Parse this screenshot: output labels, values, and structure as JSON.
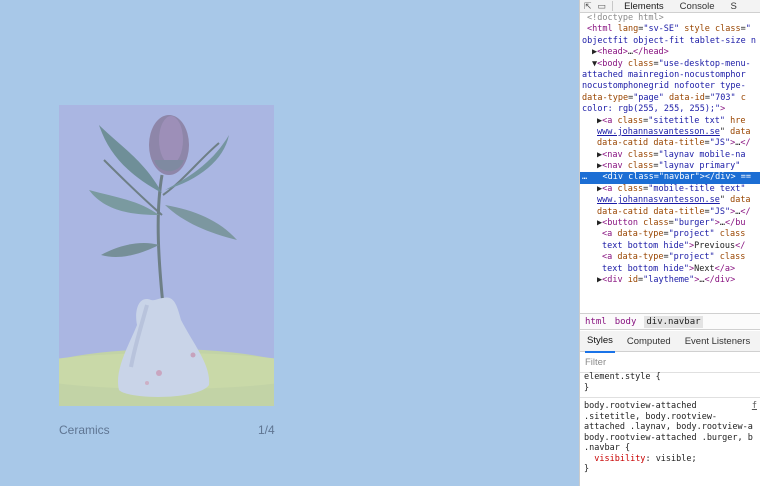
{
  "page": {
    "caption_title": "Ceramics",
    "caption_count": "1/4"
  },
  "devtools": {
    "toolbar": {
      "inspect_icon": "cursor-select-icon",
      "device_icon": "device-toggle-icon",
      "tabs": [
        "Elements",
        "Console",
        "S"
      ]
    },
    "elements_lines": [
      {
        "indent": 1,
        "html": "<span class='c-com'>&lt;!doctype html&gt;</span>"
      },
      {
        "indent": 1,
        "html": "<span class='c-tag'>&lt;html</span> <span class='c-attr'>lang</span>=<span class='c-val'>\"sv-SE\"</span> <span class='c-attr'>style</span> <span class='c-attr'>class</span>=<span class='c-val'>\"</span>"
      },
      {
        "indent": 0,
        "html": "<span class='c-val'>objectfit object-fit tablet-size n</span>"
      },
      {
        "indent": 2,
        "html": "▶<span class='c-tag'>&lt;head&gt;</span>…<span class='c-tag'>&lt;/head&gt;</span>"
      },
      {
        "indent": 2,
        "html": "▼<span class='c-tag'>&lt;body</span> <span class='c-attr'>class</span>=<span class='c-val'>\"use-desktop-menu-</span>"
      },
      {
        "indent": 0,
        "html": "<span class='c-val'>attached mainregion-nocustomphor</span>"
      },
      {
        "indent": 0,
        "html": "<span class='c-val'>nocustomphonegrid nofooter type-</span>"
      },
      {
        "indent": 0,
        "html": "<span class='c-attr'>data-type</span>=<span class='c-val'>\"page\"</span> <span class='c-attr'>data-id</span>=<span class='c-val'>\"703\"</span> <span class='c-attr'>c</span>"
      },
      {
        "indent": 0,
        "html": "<span class='c-val'>color: rgb(255, 255, 255);\"</span><span class='c-tag'>&gt;</span>"
      },
      {
        "indent": 3,
        "html": "▶<span class='c-tag'>&lt;a</span> <span class='c-attr'>class</span>=<span class='c-val'>\"sitetitle txt\"</span> <span class='c-attr'>hre</span>"
      },
      {
        "indent": 3,
        "html": "<span class='c-link'>www.johannasvantesson.se</span>\" <span class='c-attr'>data</span>"
      },
      {
        "indent": 3,
        "html": "<span class='c-attr'>data-catid</span> <span class='c-attr'>data-title</span>=<span class='c-val'>\"JS\"</span><span class='c-tag'>&gt;</span>…<span class='c-tag'>&lt;/</span>"
      },
      {
        "indent": 3,
        "html": "▶<span class='c-tag'>&lt;nav</span> <span class='c-attr'>class</span>=<span class='c-val'>\"laynav mobile-na</span>"
      },
      {
        "indent": 3,
        "html": "▶<span class='c-tag'>&lt;nav</span> <span class='c-attr'>class</span>=<span class='c-val'>\"laynav primary\"</span>"
      },
      {
        "indent": 0,
        "selected": true,
        "html": "…&nbsp;&nbsp;&nbsp;<span class='c-tag'>&lt;div</span> <span class='c-attr'>class</span>=<span class='c-val'>\"navbar\"</span><span class='c-tag'>&gt;&lt;/div&gt;</span> =="
      },
      {
        "indent": 3,
        "html": "▶<span class='c-tag'>&lt;a</span> <span class='c-attr'>class</span>=<span class='c-val'>\"mobile-title text\"</span>"
      },
      {
        "indent": 3,
        "html": "<span class='c-link'>www.johannasvantesson.se</span>\" <span class='c-attr'>data</span>"
      },
      {
        "indent": 3,
        "html": "<span class='c-attr'>data-catid</span> <span class='c-attr'>data-title</span>=<span class='c-val'>\"JS\"</span><span class='c-tag'>&gt;</span>…<span class='c-tag'>&lt;/</span>"
      },
      {
        "indent": 3,
        "html": "▶<span class='c-tag'>&lt;button</span> <span class='c-attr'>class</span>=<span class='c-val'>\"burger\"</span><span class='c-tag'>&gt;</span>…<span class='c-tag'>&lt;/bu</span>"
      },
      {
        "indent": 4,
        "html": "<span class='c-tag'>&lt;a</span> <span class='c-attr'>data-type</span>=<span class='c-val'>\"project\"</span> <span class='c-attr'>class</span>"
      },
      {
        "indent": 4,
        "html": "<span class='c-val'>text bottom hide\"</span><span class='c-tag'>&gt;</span>Previous<span class='c-tag'>&lt;/</span>"
      },
      {
        "indent": 4,
        "html": "<span class='c-tag'>&lt;a</span> <span class='c-attr'>data-type</span>=<span class='c-val'>\"project\"</span> <span class='c-attr'>class</span>"
      },
      {
        "indent": 4,
        "html": "<span class='c-val'>text bottom hide\"</span><span class='c-tag'>&gt;</span>Next<span class='c-tag'>&lt;/a&gt;</span>"
      },
      {
        "indent": 3,
        "html": "▶<span class='c-tag'>&lt;div</span> <span class='c-attr'>id</span>=<span class='c-val'>\"laytheme\"</span><span class='c-tag'>&gt;</span>…<span class='c-tag'>&lt;/div&gt;</span>"
      }
    ],
    "breadcrumb": [
      "html",
      "body",
      "div.navbar"
    ],
    "subtabs": [
      "Styles",
      "Computed",
      "Event Listeners"
    ],
    "filter_placeholder": "Filter",
    "styles": {
      "element_style_open": "element.style {",
      "element_style_close": "}",
      "rule_selector_lines": [
        "body.rootview-attached",
        ".sitetitle, body.rootview-",
        "attached .laynav, body.rootview-a",
        "body.rootview-attached .burger, b",
        ".navbar {"
      ],
      "source_link": "f",
      "property": "visibility",
      "value": "visible",
      "rule_close": "}"
    }
  }
}
